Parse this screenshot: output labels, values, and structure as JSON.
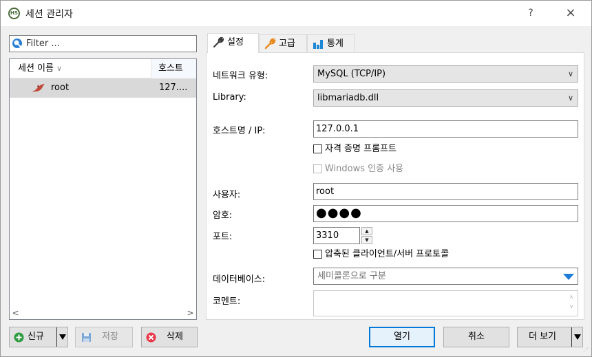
{
  "window": {
    "title": "세션 관리자",
    "icon_text": "HS",
    "help_label": "?",
    "close_label": "×"
  },
  "left": {
    "filter_placeholder": "Filter ...",
    "columns": [
      "세션 이름",
      "호스트"
    ],
    "sessions": [
      {
        "name": "root",
        "host": "127...."
      }
    ]
  },
  "tabs": [
    {
      "label": "설정",
      "icon": "wrench-icon",
      "active": true
    },
    {
      "label": "고급",
      "icon": "wrench-orange-icon",
      "active": false
    },
    {
      "label": "통계",
      "icon": "bar-chart-icon",
      "active": false
    }
  ],
  "settings": {
    "network_type_label": "네트워크 유형:",
    "network_type_value": "MySQL (TCP/IP)",
    "library_label": "Library:",
    "library_value": "libmariadb.dll",
    "hostname_label": "호스트명 / IP:",
    "hostname_value": "127.0.0.1",
    "prompt_credentials_label": "자격 증명 프롬프트",
    "prompt_credentials_checked": false,
    "windows_auth_label": "Windows 인증 사용",
    "windows_auth_checked": false,
    "user_label": "사용자:",
    "user_value": "root",
    "password_label": "암호:",
    "password_value": "●●●●",
    "port_label": "포트:",
    "port_value": "3310",
    "compressed_label": "압축된 클라이언트/서버 프로토콜",
    "compressed_checked": false,
    "databases_label": "데이터베이스:",
    "databases_placeholder": "세미콜론으로 구분",
    "comment_label": "코멘트:",
    "comment_value": ""
  },
  "buttons": {
    "new_label": "신규",
    "save_label": "저장",
    "delete_label": "삭제",
    "open_label": "열기",
    "cancel_label": "취소",
    "more_label": "더 보기"
  },
  "colors": {
    "accent": "#0078d7",
    "selected_row": "#d9d9d9",
    "dropdown_triangle": "#1e7bd6",
    "delete_icon": "#e8394a",
    "new_icon": "#2e9b41"
  }
}
